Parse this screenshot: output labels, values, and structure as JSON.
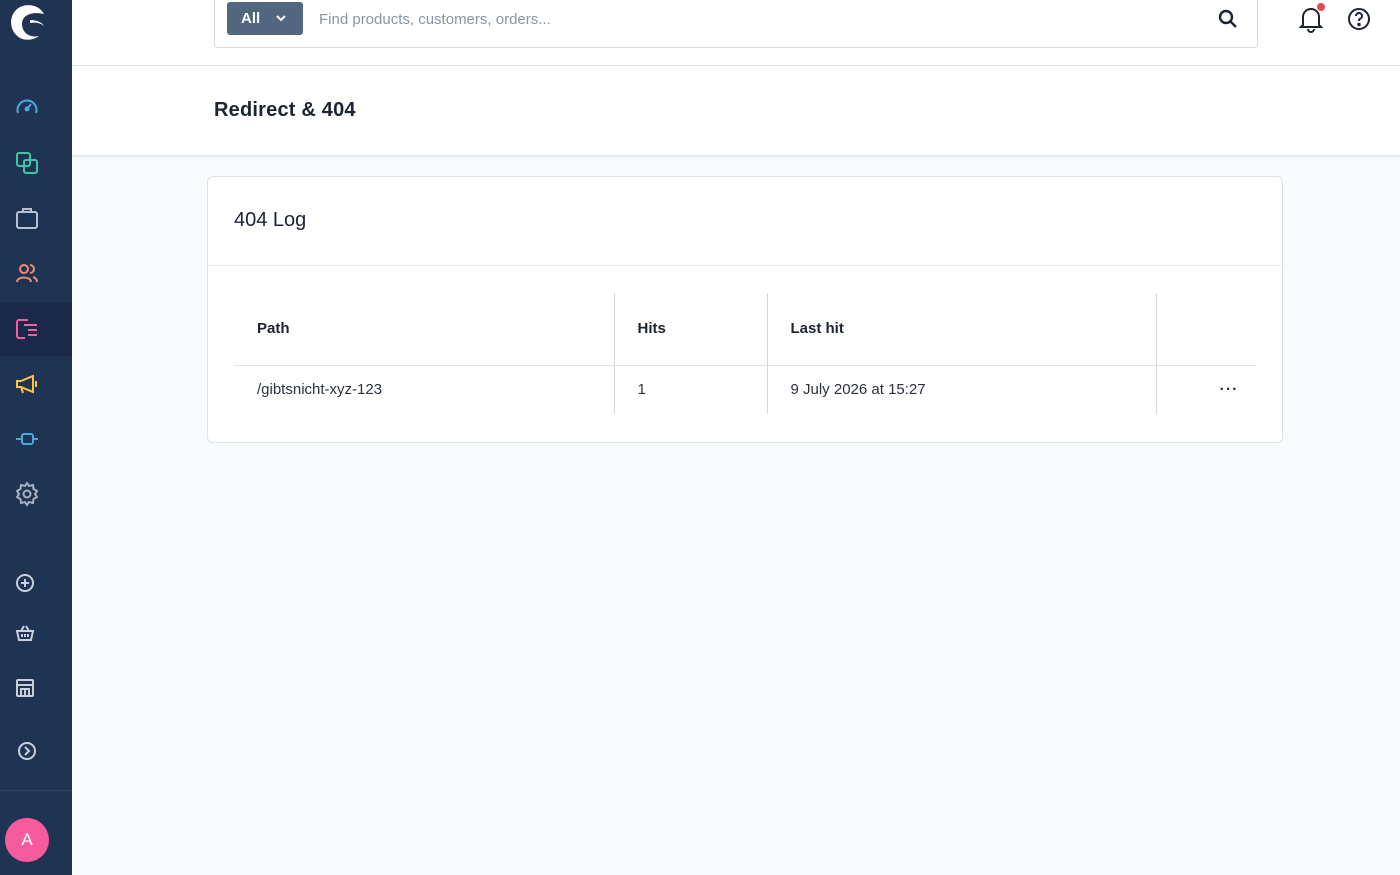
{
  "search": {
    "type_label": "All",
    "placeholder": "Find products, customers, orders..."
  },
  "sidebar": {
    "items": [
      {
        "icon": "dashboard-icon",
        "color": "#4aa8e0"
      },
      {
        "icon": "catalogue-icon",
        "color": "#3fc6a2"
      },
      {
        "icon": "orders-icon",
        "color": "#b6c2d4"
      },
      {
        "icon": "customers-icon",
        "color": "#f08a78"
      },
      {
        "icon": "content-icon",
        "color": "#f25fa0"
      },
      {
        "icon": "marketing-icon",
        "color": "#ffc53a"
      },
      {
        "icon": "extensions-icon",
        "color": "#4aa8e0"
      },
      {
        "icon": "settings-icon",
        "color": "#a6b1c2"
      },
      {
        "icon": "add-sales-channel-icon",
        "color": "#c8d0dc"
      },
      {
        "icon": "storefront-basket-icon",
        "color": "#c8d0dc"
      },
      {
        "icon": "headless-store-icon",
        "color": "#c8d0dc"
      },
      {
        "icon": "expand-sidebar-icon",
        "color": "#c8d0dc"
      }
    ],
    "avatar_initial": "A"
  },
  "page": {
    "title": "Redirect & 404"
  },
  "card": {
    "title": "404 Log",
    "columns": [
      "Path",
      "Hits",
      "Last hit"
    ],
    "rows": [
      {
        "path": "/gibtsnicht-xyz-123",
        "hits": "1",
        "last_hit": "9 July 2026 at 15:27"
      }
    ]
  }
}
